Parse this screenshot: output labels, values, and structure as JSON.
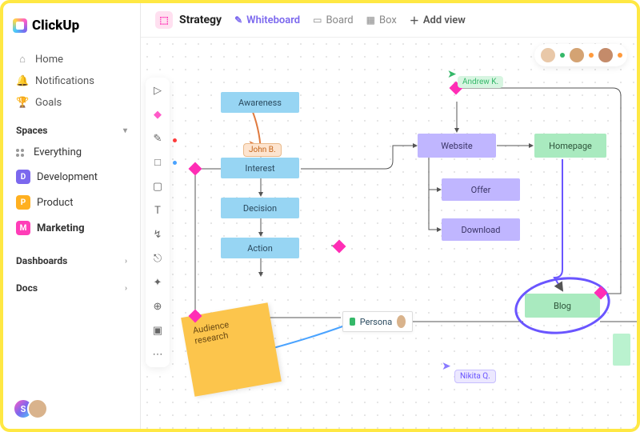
{
  "brand": "ClickUp",
  "nav": {
    "home": "Home",
    "notifications": "Notifications",
    "goals": "Goals"
  },
  "spaces": {
    "header": "Spaces",
    "everything": "Everything",
    "items": [
      {
        "letter": "D",
        "label": "Development",
        "color": "#7b68ee"
      },
      {
        "letter": "P",
        "label": "Product",
        "color": "#ffb020"
      },
      {
        "letter": "M",
        "label": "Marketing",
        "color": "#ff3db8"
      }
    ]
  },
  "sections": {
    "dashboards": "Dashboards",
    "docs": "Docs"
  },
  "topbar": {
    "title": "Strategy",
    "views": {
      "whiteboard": "Whiteboard",
      "board": "Board",
      "box": "Box",
      "add": "Add view"
    }
  },
  "cursors": {
    "andrew": "Andrew K.",
    "john": "John B.",
    "nikita": "Nikita Q."
  },
  "nodes": {
    "awareness": "Awareness",
    "interest": "Interest",
    "decision": "Decision",
    "action": "Action",
    "website": "Website",
    "offer": "Offer",
    "download": "Download",
    "homepage": "Homepage",
    "blog": "Blog",
    "persona": "Persona"
  },
  "sticky": "Audience research",
  "bottom_avatars": {
    "initial": "S"
  }
}
